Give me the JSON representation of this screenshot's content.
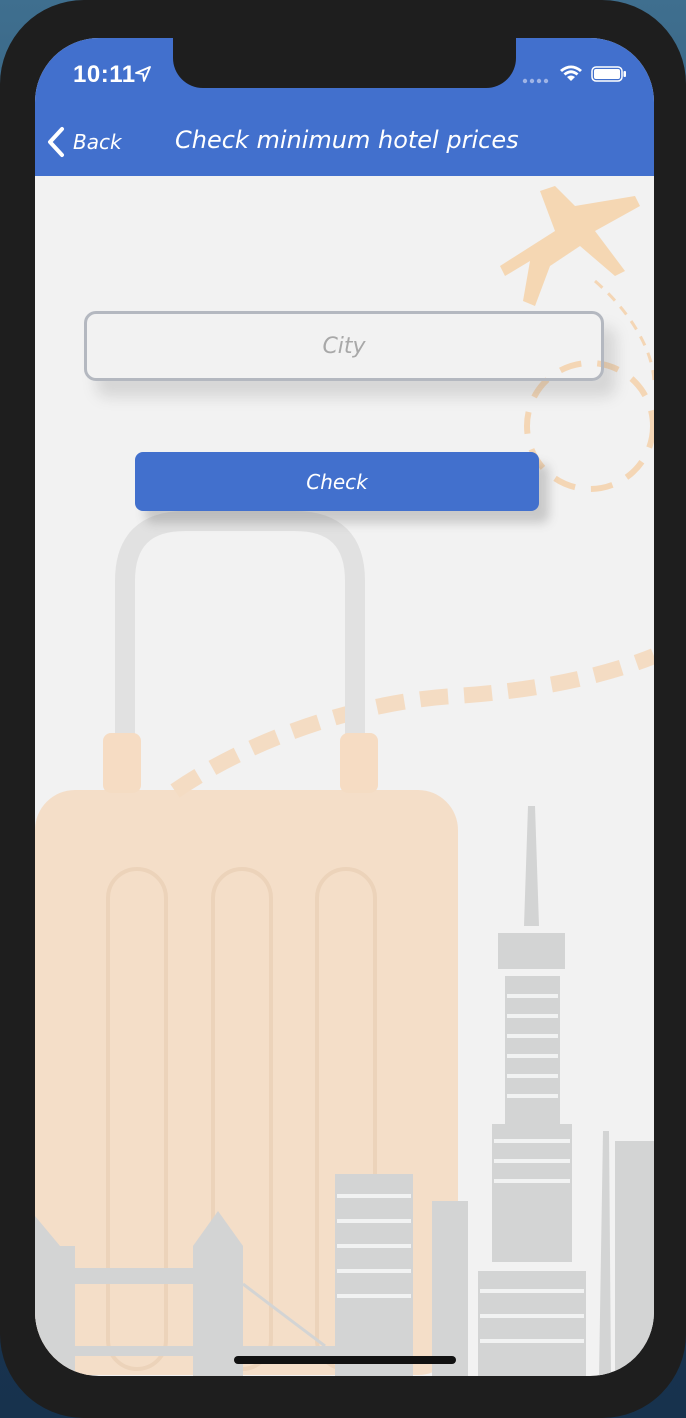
{
  "status_bar": {
    "time": "10:11"
  },
  "nav": {
    "back_label": "Back",
    "title": "Check minimum hotel prices"
  },
  "form": {
    "city_placeholder": "City",
    "city_value": "",
    "check_label": "Check"
  },
  "icons": {
    "location": "location-arrow-icon",
    "signal": "cellular-signal-icon",
    "wifi": "wifi-icon",
    "battery": "battery-icon",
    "back": "chevron-left-icon"
  },
  "colors": {
    "accent": "#4270cd",
    "background": "#f2f2f2",
    "illustration_orange": "#f3d9bd",
    "illustration_gray": "#d3d4d4"
  }
}
